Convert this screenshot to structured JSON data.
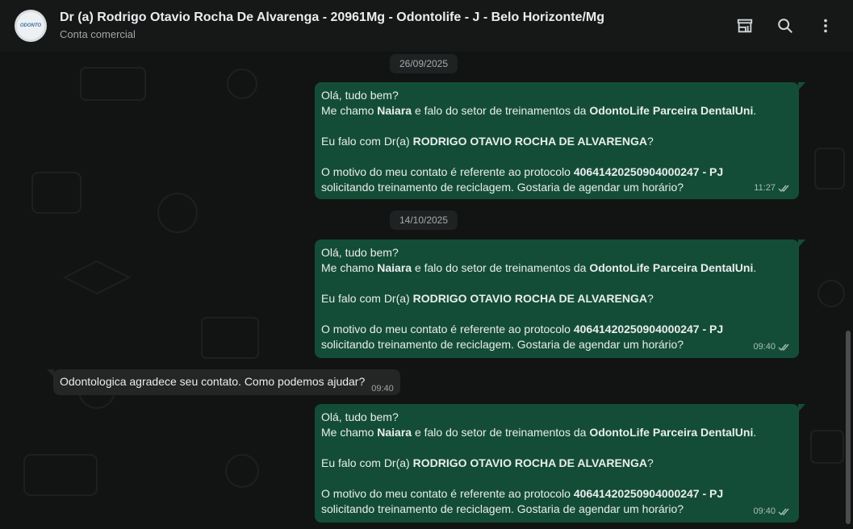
{
  "header": {
    "title": "Dr (a) Rodrigo Otavio Rocha De Alvarenga - 20961Mg - Odontolife - J - Belo Horizonte/Mg",
    "subtitle": "Conta comercial",
    "avatar_text": "ODONTO",
    "icons": [
      "catalog-icon",
      "search-icon",
      "menu-icon"
    ]
  },
  "dates": [
    "26/09/2025",
    "14/10/2025"
  ],
  "outgoing_message": {
    "line1": "Olá, tudo bem?",
    "line2_pre": "Me chamo ",
    "line2_name": "Naiara",
    "line2_mid": " e falo do setor de treinamentos da ",
    "line2_company": "OdontoLife Parceira DentalUni",
    "line2_end": ".",
    "line3_pre": "Eu falo com Dr(a) ",
    "line3_doctor": "RODRIGO OTAVIO ROCHA DE ALVARENGA",
    "line3_end": "?",
    "line4_pre": "O motivo do meu contato é referente ao protocolo ",
    "line4_protocol": "40641420250904000247 - PJ",
    "line5": "solicitando treinamento de reciclagem. Gostaria de agendar um horário?"
  },
  "messages": {
    "m1_time": "11:27",
    "m2_time": "09:40",
    "m3_text": "Odontologica agradece seu contato. Como podemos ajudar?",
    "m3_time": "09:40",
    "m4_time": "09:40"
  },
  "colors": {
    "outgoing_bubble": "#144d37",
    "incoming_bubble": "#242626",
    "background": "#121414"
  }
}
